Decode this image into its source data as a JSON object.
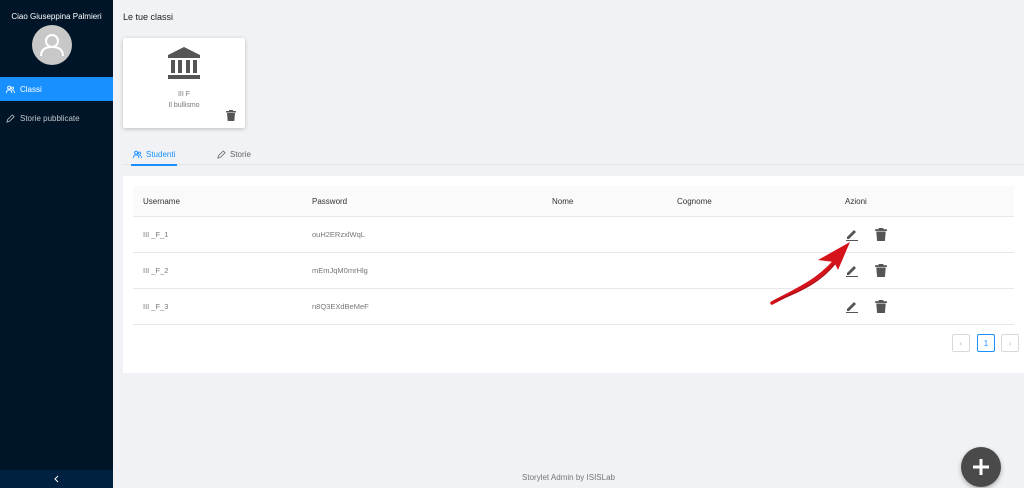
{
  "sidebar": {
    "greeting": "Ciao Giuseppina Palmieri",
    "items": [
      {
        "label": "Classi",
        "active": true
      },
      {
        "label": "Storie pubblicate",
        "active": false
      }
    ],
    "collapse_icon": "chevron-left-icon"
  },
  "page": {
    "title": "Le tue classi"
  },
  "class_card": {
    "icon": "bank-icon",
    "name": "III F",
    "subtitle": "Il bullismo"
  },
  "tabs": [
    {
      "label": "Studenti",
      "active": true
    },
    {
      "label": "Storie",
      "active": false
    }
  ],
  "table": {
    "columns": [
      "Username",
      "Password",
      "Nome",
      "Cognome",
      "Azioni"
    ],
    "rows": [
      {
        "username": "III _F_1",
        "password": "ouH2ERzxlWqL",
        "nome": "",
        "cognome": ""
      },
      {
        "username": "III _F_2",
        "password": "mEmJqM0mrHlg",
        "nome": "",
        "cognome": ""
      },
      {
        "username": "III _F_3",
        "password": "n8Q3EXdBeMeF",
        "nome": "",
        "cognome": ""
      }
    ]
  },
  "pagination": {
    "current": "1",
    "prev": "‹",
    "next": "›"
  },
  "footer": "Storylet Admin by ISISLab",
  "colors": {
    "sidebar_bg": "#011529",
    "accent": "#1890ff",
    "annotation_arrow": "#d6121b",
    "fab": "#4a4a4a"
  }
}
